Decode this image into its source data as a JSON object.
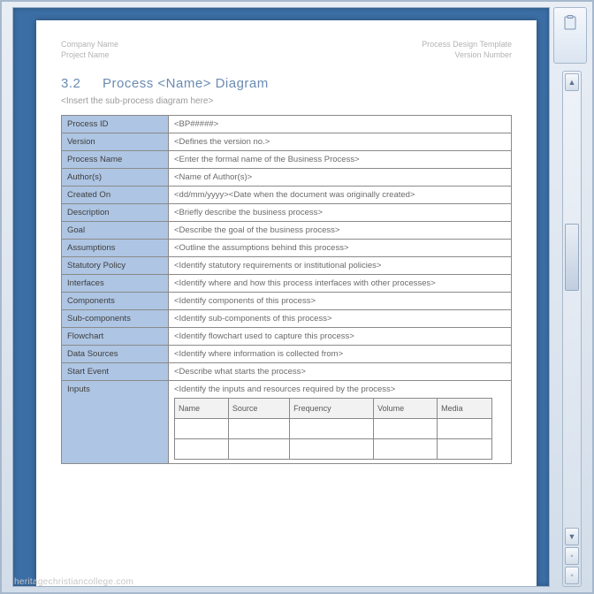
{
  "header": {
    "left_line1": "Company Name",
    "left_line2": "Project Name",
    "right_line1": "Process Design Template",
    "right_line2": "Version Number"
  },
  "section": {
    "number": "3.2",
    "title": "Process <Name> Diagram",
    "subtitle": "<Insert the sub-process diagram here>"
  },
  "rows": [
    {
      "k": "Process ID",
      "v": "<BP#####>"
    },
    {
      "k": "Version",
      "v": "<Defines the version no.>"
    },
    {
      "k": "Process Name",
      "v": "<Enter the formal name of the Business Process>"
    },
    {
      "k": "Author(s)",
      "v": "<Name of Author(s)>"
    },
    {
      "k": "Created On",
      "v": "<dd/mm/yyyy><Date when the document was originally created>"
    },
    {
      "k": "Description",
      "v": "<Briefly describe the business process>"
    },
    {
      "k": "Goal",
      "v": "<Describe the goal of the business process>"
    },
    {
      "k": "Assumptions",
      "v": "<Outline the assumptions behind this process>"
    },
    {
      "k": "Statutory Policy",
      "v": "<Identify statutory requirements or institutional policies>"
    },
    {
      "k": "Interfaces",
      "v": "<Identify where and how this process interfaces with other processes>"
    },
    {
      "k": "Components",
      "v": "<Identify components of this process>"
    },
    {
      "k": "Sub-components",
      "v": "<Identify sub-components of this process>"
    },
    {
      "k": "Flowchart",
      "v": "<Identify flowchart used to capture this process>"
    },
    {
      "k": "Data Sources",
      "v": "<Identify where information is collected from>"
    },
    {
      "k": "Start Event",
      "v": "<Describe what starts the process>"
    }
  ],
  "inputs": {
    "label": "Inputs",
    "note": "<Identify the inputs and resources required by the process>",
    "cols": [
      "Name",
      "Source",
      "Frequency",
      "Volume",
      "Media"
    ]
  },
  "watermark": "heritagechristiancollege.com"
}
